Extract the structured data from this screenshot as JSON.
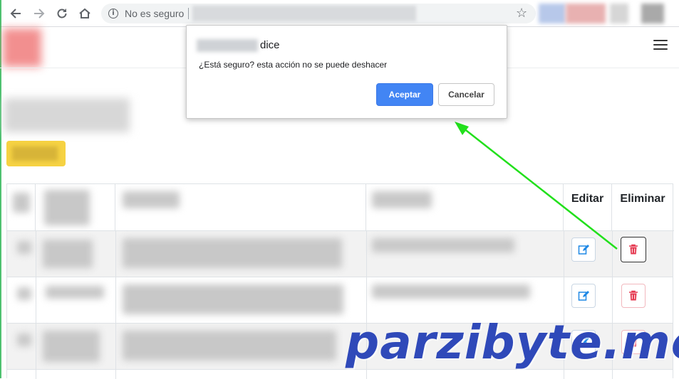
{
  "browser": {
    "security_label": "No es seguro",
    "icons": [
      "back-icon",
      "forward-icon",
      "reload-icon",
      "home-icon",
      "info-icon",
      "star-icon"
    ]
  },
  "dialog": {
    "title": "dice",
    "message": "¿Está seguro? esta acción no se puede deshacer",
    "ok_label": "Aceptar",
    "cancel_label": "Cancelar"
  },
  "table": {
    "headers": {
      "edit": "Editar",
      "delete": "Eliminar"
    }
  },
  "watermark": "parzibyte.me",
  "colors": {
    "accent": "#4285f4",
    "annotation_arrow": "#22e01c",
    "watermark": "#2f49b9",
    "highlight_button": "#f6d243",
    "edit_icon": "#1e88e5",
    "delete_icon": "#e53950"
  }
}
